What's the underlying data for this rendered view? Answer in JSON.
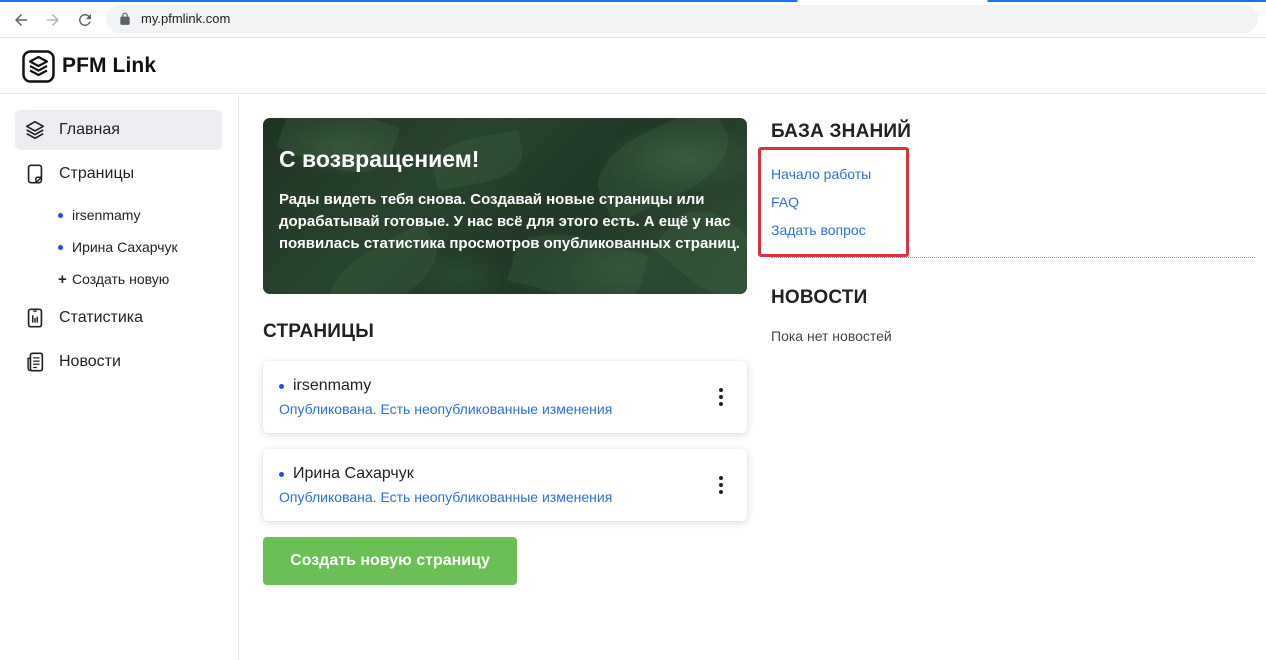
{
  "browser": {
    "url": "my.pfmlink.com",
    "back_icon": "arrow-left-icon",
    "forward_icon": "arrow-right-icon",
    "reload_icon": "reload-icon",
    "lock_icon": "lock-icon"
  },
  "header": {
    "logo_text": "PFM Link",
    "logo_icon": "layers-icon"
  },
  "sidebar": {
    "items": [
      {
        "label": "Главная",
        "icon": "layers-icon",
        "active": true
      },
      {
        "label": "Страницы",
        "icon": "phone-page-icon",
        "active": false
      },
      {
        "label": "Статистика",
        "icon": "stats-icon",
        "active": false
      },
      {
        "label": "Новости",
        "icon": "news-icon",
        "active": false
      }
    ],
    "pages_sub": [
      {
        "label": "irsenmamy"
      },
      {
        "label": "Ирина Сахарчук"
      }
    ],
    "create_new": {
      "symbol": "+",
      "label": "Создать новую"
    }
  },
  "hero": {
    "title": "С возвращением!",
    "text": "Рады видеть тебя снова. Создавай новые страницы или дорабатывай готовые. У нас всё для этого есть. А ещё у нас появилась статистика просмотров опубликованных страниц."
  },
  "pages_section": {
    "title": "СТРАНИЦЫ",
    "cards": [
      {
        "name": "irsenmamy",
        "status": "Опубликована. Есть неопубликованные изменения"
      },
      {
        "name": "Ирина Сахарчук",
        "status": "Опубликована. Есть неопубликованные изменения"
      }
    ],
    "create_button": "Создать новую страницу"
  },
  "knowledge_base": {
    "title": "БАЗА ЗНАНИЙ",
    "links": [
      {
        "label": "Начало работы"
      },
      {
        "label": "FAQ"
      },
      {
        "label": "Задать вопрос"
      }
    ],
    "highlight_color": "#d9343c"
  },
  "news": {
    "title": "НОВОСТИ",
    "empty_text": "Пока нет новостей"
  },
  "colors": {
    "accent_blue": "#2e6fd8",
    "dot_blue": "#1a4dff",
    "create_green": "#6abf55",
    "active_bg": "#ecedf0"
  }
}
